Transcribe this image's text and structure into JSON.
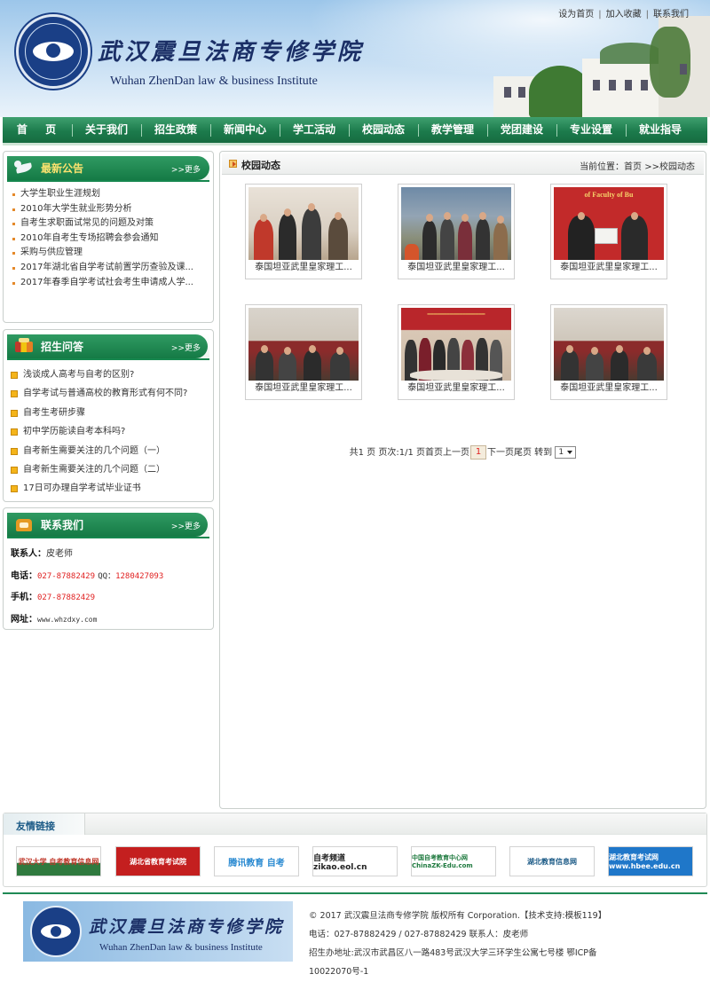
{
  "header": {
    "title_cn": "武汉震旦法商专修学院",
    "title_en": "Wuhan ZhenDan law & business Institute",
    "top_links": [
      "设为首页",
      "加入收藏",
      "联系我们"
    ]
  },
  "nav": [
    "首 页",
    "关于我们",
    "招生政策",
    "新闻中心",
    "学工活动",
    "校园动态",
    "教学管理",
    "党团建设",
    "专业设置",
    "就业指导"
  ],
  "sidebar": {
    "news": {
      "title": "最新公告",
      "more": ">>更多",
      "items": [
        "大学生职业生涯规划",
        "2010年大学生就业形势分析",
        "自考生求职面试常见的问题及对策",
        "2010年自考生专场招聘会参会通知",
        "采购与供应管理",
        "2017年湖北省自学考试前置学历查验及课...",
        "2017年春季自学考试社会考生申请成人学..."
      ]
    },
    "qa": {
      "title": "招生问答",
      "more": ">>更多",
      "items": [
        "浅谈成人高考与自考的区别?",
        "自学考试与普通高校的教育形式有何不同?",
        "自考生考研步骤",
        "初中学历能读自考本科吗?",
        "自考新生需要关注的几个问题（一）",
        "自考新生需要关注的几个问题（二）",
        "17日可办理自学考试毕业证书"
      ]
    },
    "contact": {
      "title": "联系我们",
      "more": ">>更多",
      "person_label": "联系人：",
      "person": "皮老师",
      "phone_label": "电话：",
      "phone": "027-87882429",
      "qq_label": "QQ：",
      "qq": "1280427093",
      "mobile_label": "手机：",
      "mobile": "027-87882429",
      "web_label": "网址：",
      "web": "www.whzdxy.com"
    }
  },
  "main": {
    "title": "校园动态",
    "breadcrumb": "当前位置：首页 >>校园动态",
    "photos": [
      "泰国坦亚武里皇家理工...",
      "泰国坦亚武里皇家理工...",
      "泰国坦亚武里皇家理工...",
      "泰国坦亚武里皇家理工...",
      "泰国坦亚武里皇家理工...",
      "泰国坦亚武里皇家理工..."
    ],
    "pager": {
      "before": "共1 页 页次:1/1 页首页上一页",
      "current": "1",
      "after": "下一页尾页 转到",
      "select": "1"
    }
  },
  "links": {
    "title": "友情链接",
    "items": [
      "武汉大学 自考教育信息网",
      "湖北省教育考试院",
      "腾讯教育 自考",
      "自考频道 zikao.eol.cn",
      "中国自考教育中心网 ChinaZK-Edu.com",
      "湖北教育信息网",
      "湖北教育考试网 www.hbee.edu.cn"
    ]
  },
  "footer": {
    "title_cn": "武汉震旦法商专修学院",
    "title_en": "Wuhan ZhenDan law & business Institute",
    "line1": "© 2017 武汉震旦法商专修学院 版权所有 Corporation.【技术支持:模板119】",
    "line2": "电话：027-87882429 / 027-87882429 联系人：皮老师",
    "line3": "招生办地址:武汉市武昌区八一路483号武汉大学三环学生公寓七号楼        鄂ICP备",
    "line4": "10022070号-1"
  }
}
